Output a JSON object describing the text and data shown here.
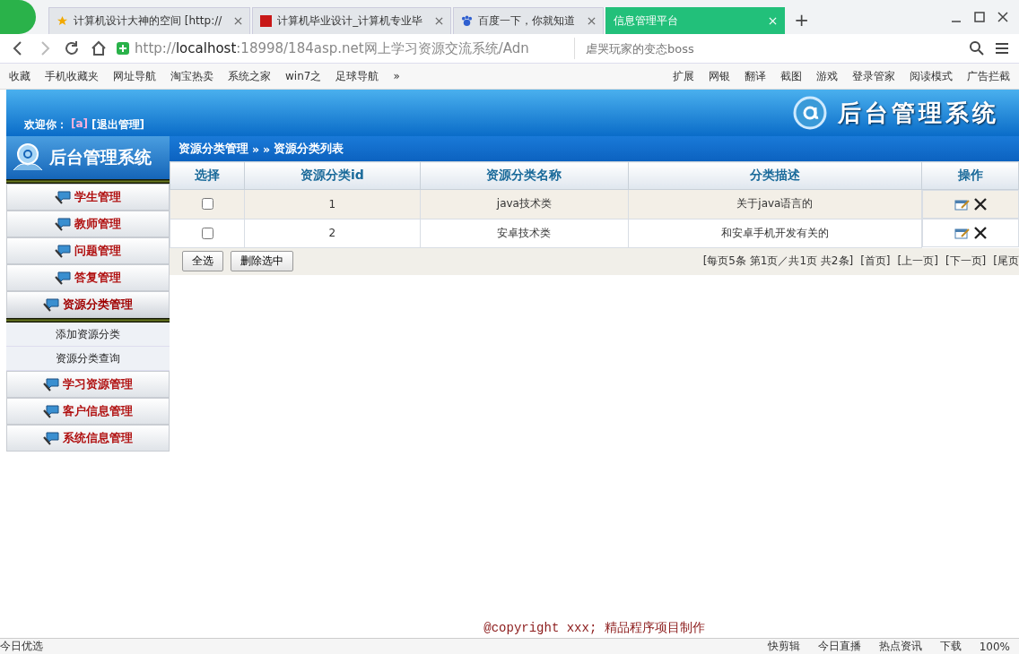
{
  "browser": {
    "tabs": [
      {
        "title": "计算机设计大神的空间 [http://",
        "selected": false
      },
      {
        "title": "计算机毕业设计_计算机专业毕",
        "selected": false
      },
      {
        "title": "百度一下，你就知道",
        "selected": false
      },
      {
        "title": "信息管理平台",
        "selected": true
      }
    ],
    "new_tab": "+",
    "address": {
      "url_prefix": "http://",
      "host": "localhost",
      "url_rest": ":18998/184asp.net网上学习资源交流系统/Adn"
    },
    "search": {
      "placeholder": "虐哭玩家的变态boss"
    },
    "bookmarks": [
      "收藏",
      "手机收藏夹",
      "网址导航",
      "淘宝热卖",
      "系统之家",
      "win7之",
      "足球导航"
    ],
    "bookmarks_more": "»",
    "extensions": [
      "扩展",
      "网银",
      "翻译",
      "截图",
      "游戏",
      "登录管家",
      "阅读模式",
      "广告拦截"
    ]
  },
  "header": {
    "welcome": "欢迎你：",
    "user": "[a]",
    "logout": "[退出管理]",
    "title": "后台管理系统"
  },
  "sidebar": {
    "logo": "后台管理系统",
    "items": [
      {
        "label": "学生管理",
        "expanded": false
      },
      {
        "label": "教师管理",
        "expanded": false
      },
      {
        "label": "问题管理",
        "expanded": false
      },
      {
        "label": "答复管理",
        "expanded": false
      },
      {
        "label": "资源分类管理",
        "expanded": true,
        "children": [
          {
            "label": "添加资源分类"
          },
          {
            "label": "资源分类查询"
          }
        ]
      },
      {
        "label": "学习资源管理",
        "expanded": false
      },
      {
        "label": "客户信息管理",
        "expanded": false
      },
      {
        "label": "系统信息管理",
        "expanded": false
      }
    ]
  },
  "breadcrumb": [
    "资源分类管理",
    "»",
    "»",
    "资源分类列表"
  ],
  "table": {
    "columns": [
      "选择",
      "资源分类id",
      "资源分类名称",
      "分类描述",
      "操作"
    ],
    "rows": [
      {
        "checked": false,
        "id": "1",
        "name": "java技术类",
        "description": "关于java语言的"
      },
      {
        "checked": false,
        "id": "2",
        "name": "安卓技术类",
        "description": "和安卓手机开发有关的"
      }
    ]
  },
  "actions": [
    "全选",
    "删除选中"
  ],
  "pager": {
    "summary": "[每页5条 第1页／共1页 共2条]",
    "links": [
      "[首页]",
      "[上一页]",
      "[下一页]",
      "[尾页"
    ]
  },
  "footer": "@copyright xxx; 精品程序项目制作",
  "status_bar": {
    "left": "今日优选",
    "items": [
      "快剪辑",
      "今日直播",
      "热点资讯",
      "下载"
    ],
    "zoom": "100%"
  }
}
